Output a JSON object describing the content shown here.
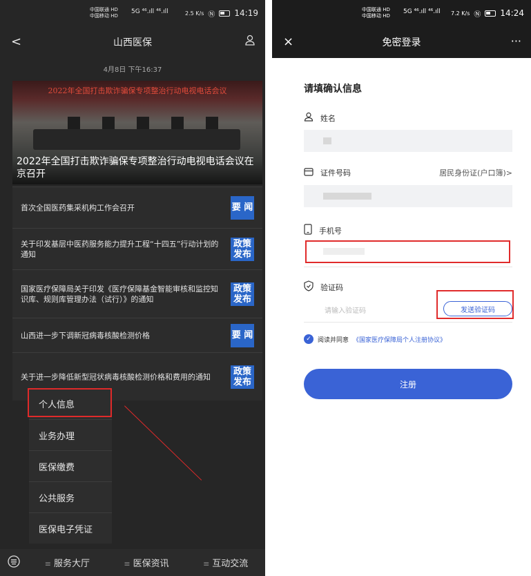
{
  "left": {
    "status": {
      "carriers": [
        "中国联通 HD",
        "中国移动 HD"
      ],
      "signal": "5G ⁴⁶.ıll ⁴⁶.ıll",
      "speed": "2.5 K/s",
      "time": "14:19"
    },
    "nav": {
      "back": "<",
      "title": "山西医保",
      "profile_icon": "person-icon"
    },
    "date": "4月8日 下午16:37",
    "hero": {
      "banner": "2022年全国打击欺诈骗保专项整治行动电视电话会议",
      "caption": "2022年全国打击欺诈骗保专项整治行动电视电话会议在京召开"
    },
    "news": [
      {
        "text": "首次全国医药集采机构工作会召开",
        "tag": "要 闻"
      },
      {
        "text": "关于印发基层中医药服务能力提升工程“十四五”行动计划的通知",
        "tag": "政策发布"
      },
      {
        "text": "国家医疗保障局关于印发《医疗保障基金智能审核和监控知识库、规则库管理办法（试行）》的通知",
        "tag": "政策发布"
      },
      {
        "text": "山西进一步下调新冠病毒核酸检测价格",
        "tag": "要 闻"
      },
      {
        "text": "关于进一步降低新型冠状病毒核酸检测价格和费用的通知",
        "tag": "政策发布"
      }
    ],
    "menu": [
      "个人信息",
      "业务办理",
      "医保缴费",
      "公共服务",
      "医保电子凭证"
    ],
    "bottom": {
      "tabs": [
        "服务大厅",
        "医保资讯",
        "互动交流"
      ],
      "keyboard_icon": "keyboard-icon"
    }
  },
  "right": {
    "status": {
      "carriers": [
        "中国联通 HD",
        "中国移动 HD"
      ],
      "signal": "5G ⁴⁶.ıll ⁴⁶.ıll",
      "speed": "7.2 K/s",
      "time": "14:24"
    },
    "nav": {
      "close": "×",
      "title": "免密登录",
      "more": "···"
    },
    "form": {
      "title": "请填确认信息",
      "name_label": "姓名",
      "id_label": "证件号码",
      "id_type": "居民身份证(户口簿)>",
      "phone_label": "手机号",
      "code_label": "验证码",
      "code_placeholder": "请输入验证码",
      "send_code": "发送验证码",
      "agree_prefix": "阅读并同意",
      "agree_link": "《国家医疗保障局个人注册协议》",
      "register": "注册"
    }
  },
  "colors": {
    "accent": "#3a63d6",
    "annotation_red": "#e02a2a",
    "tag_blue": "#2a66c8",
    "dark_bg": "#262626"
  }
}
